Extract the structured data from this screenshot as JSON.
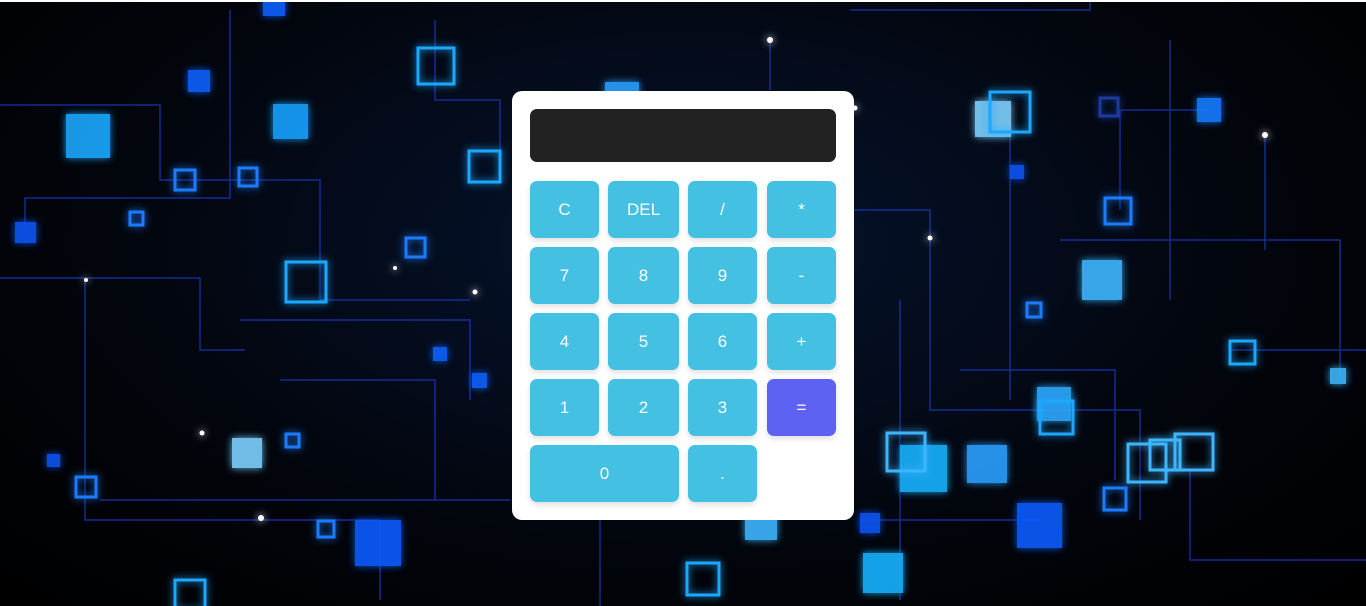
{
  "calculator": {
    "display_value": "",
    "keys": {
      "clear": "C",
      "delete": "DEL",
      "divide": "/",
      "multiply": "*",
      "seven": "7",
      "eight": "8",
      "nine": "9",
      "minus": "-",
      "four": "4",
      "five": "5",
      "six": "6",
      "plus": "+",
      "one": "1",
      "two": "2",
      "three": "3",
      "equals": "=",
      "zero": "0",
      "decimal": "."
    }
  },
  "colors": {
    "key": "#44c0e2",
    "equals_key": "#5e62f2",
    "display": "#222222",
    "panel": "#ffffff",
    "background": "#02050c"
  }
}
